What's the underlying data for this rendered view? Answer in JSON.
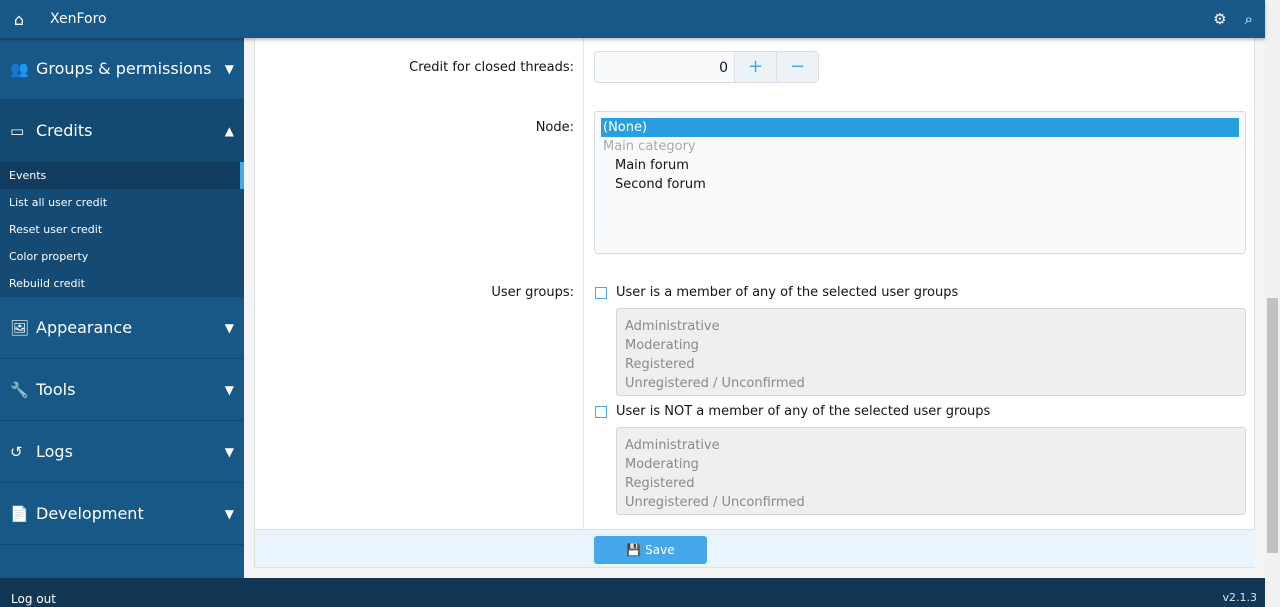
{
  "header": {
    "title": "XenForo",
    "icons": [
      "home-icon",
      "gears-icon",
      "search-icon"
    ]
  },
  "sidebar": {
    "sections": [
      {
        "label": "Groups & permissions",
        "icon": "users-icon",
        "expanded": false
      },
      {
        "label": "Credits",
        "icon": "monitor-icon",
        "expanded": true,
        "items": [
          {
            "label": "Events",
            "active": true
          },
          {
            "label": "List all user credit"
          },
          {
            "label": "Reset user credit"
          },
          {
            "label": "Color property"
          },
          {
            "label": "Rebuild credit"
          }
        ]
      },
      {
        "label": "Appearance",
        "icon": "image-icon",
        "expanded": false
      },
      {
        "label": "Tools",
        "icon": "wrench-icon",
        "expanded": false
      },
      {
        "label": "Logs",
        "icon": "history-icon",
        "expanded": false
      },
      {
        "label": "Development",
        "icon": "code-file-icon",
        "expanded": false
      }
    ]
  },
  "form": {
    "credit_closed_label": "Credit for closed threads:",
    "credit_closed_value": "0",
    "plus": "+",
    "minus": "−",
    "node_label": "Node:",
    "node_options": [
      "(None)",
      "Main category",
      "Main forum",
      "Second forum"
    ],
    "node_selected": "(None)",
    "user_groups_label": "User groups:",
    "member_label": "User is a member of any of the selected user groups",
    "not_member_label": "User is NOT a member of any of the selected user groups",
    "groups": [
      "Administrative",
      "Moderating",
      "Registered",
      "Unregistered / Unconfirmed"
    ],
    "save": "Save"
  },
  "footer": {
    "logout": "Log out",
    "version": "v2.1.3"
  },
  "colors": {
    "header": "#185886",
    "accent": "#47a7eb",
    "selected": "#2a9fe0",
    "footer": "#113754"
  }
}
